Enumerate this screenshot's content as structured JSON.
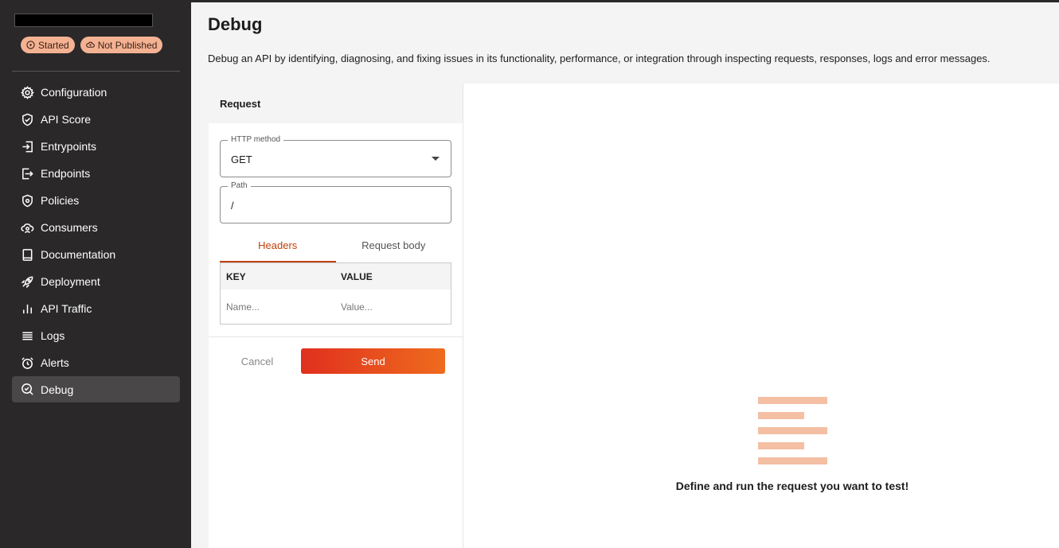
{
  "sidebar": {
    "badges": [
      {
        "label": "Started",
        "icon": "play-circle-icon"
      },
      {
        "label": "Not Published",
        "icon": "cloud-off-icon"
      }
    ],
    "items": [
      {
        "label": "Configuration",
        "icon": "gear-icon"
      },
      {
        "label": "API Score",
        "icon": "shield-check-icon"
      },
      {
        "label": "Entrypoints",
        "icon": "entry-arrow-icon"
      },
      {
        "label": "Endpoints",
        "icon": "exit-arrow-icon"
      },
      {
        "label": "Policies",
        "icon": "shield-gear-icon"
      },
      {
        "label": "Consumers",
        "icon": "cloud-user-icon"
      },
      {
        "label": "Documentation",
        "icon": "book-icon"
      },
      {
        "label": "Deployment",
        "icon": "rocket-icon"
      },
      {
        "label": "API Traffic",
        "icon": "bar-chart-icon"
      },
      {
        "label": "Logs",
        "icon": "list-icon"
      },
      {
        "label": "Alerts",
        "icon": "alarm-clock-icon"
      },
      {
        "label": "Debug",
        "icon": "search-check-icon"
      }
    ],
    "active_item": "Debug"
  },
  "header": {
    "title": "Debug",
    "description": "Debug an API by identifying, diagnosing, and fixing issues in its functionality, performance, or integration through inspecting requests, responses, logs and error messages."
  },
  "request": {
    "title": "Request",
    "method_label": "HTTP method",
    "method_value": "GET",
    "path_label": "Path",
    "path_value": "/",
    "tabs": [
      "Headers",
      "Request body"
    ],
    "active_tab": "Headers",
    "headers_table": {
      "columns": [
        "KEY",
        "VALUE"
      ],
      "key_placeholder": "Name...",
      "value_placeholder": "Value..."
    },
    "cancel_label": "Cancel",
    "send_label": "Send"
  },
  "empty_state": {
    "message": "Define and run the request you want to test!"
  },
  "colors": {
    "accent": "#c2410c",
    "send_gradient_start": "#e0301e",
    "send_gradient_end": "#ef6b1e",
    "badge_bg": "#f4b293",
    "sidebar_bg": "#2a2829"
  }
}
